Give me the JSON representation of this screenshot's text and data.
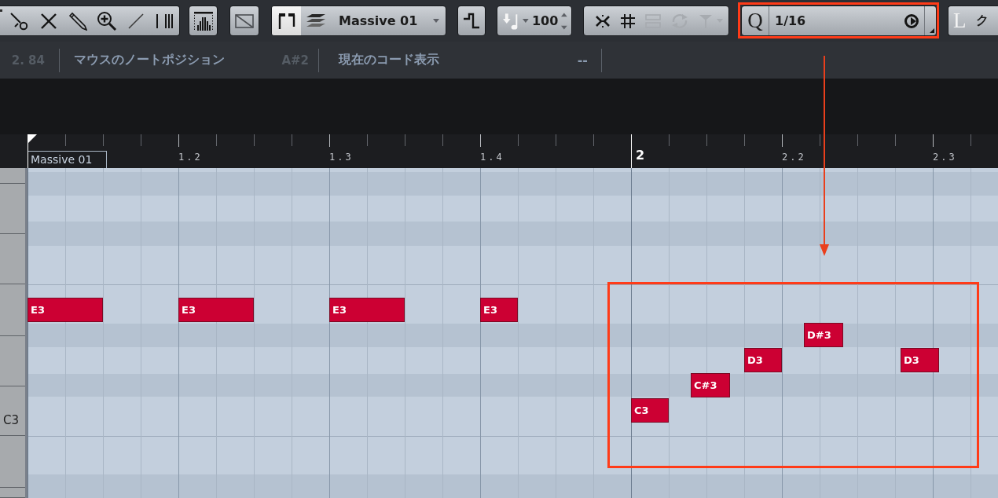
{
  "toolbar": {
    "view_modes": [
      {
        "kind": "brackets",
        "selected": true
      },
      {
        "kind": "layers",
        "selected": false
      }
    ],
    "instrument": {
      "value": "Massive 01"
    },
    "velocity": {
      "value": "100"
    },
    "snap_tools": [
      {
        "kind": "snap",
        "disabled": false
      },
      {
        "kind": "grid",
        "disabled": false
      },
      {
        "kind": "rows",
        "disabled": true
      },
      {
        "kind": "loop",
        "disabled": true
      },
      {
        "kind": "funnel",
        "disabled": true
      }
    ],
    "quantize": {
      "label": "Q",
      "value": "1/16"
    },
    "length": {
      "label": "L",
      "value": "ク"
    }
  },
  "info_bar": {
    "position": "2. 84",
    "mouse_note_label": "マウスのノートポジション",
    "mouse_note": "A#2",
    "chord_label": "現在のコード表示",
    "chord": "--"
  },
  "ruler": {
    "part_name": "Massive 01",
    "markers": [
      {
        "kind": "beat",
        "label": "1.2"
      },
      {
        "kind": "beat",
        "label": "1.3"
      },
      {
        "kind": "beat",
        "label": "1.4"
      },
      {
        "kind": "bar",
        "label": "2"
      },
      {
        "kind": "beat",
        "label": "2.2"
      },
      {
        "kind": "beat",
        "label": "2.3"
      }
    ]
  },
  "keyboard": {
    "octave_label": "C3"
  },
  "notes": [
    {
      "label": "E3"
    },
    {
      "label": "E3"
    },
    {
      "label": "E3"
    },
    {
      "label": "E3"
    },
    {
      "label": "C3"
    },
    {
      "label": "C#3"
    },
    {
      "label": "D3"
    },
    {
      "label": "D#3"
    },
    {
      "label": "D3"
    }
  ]
}
